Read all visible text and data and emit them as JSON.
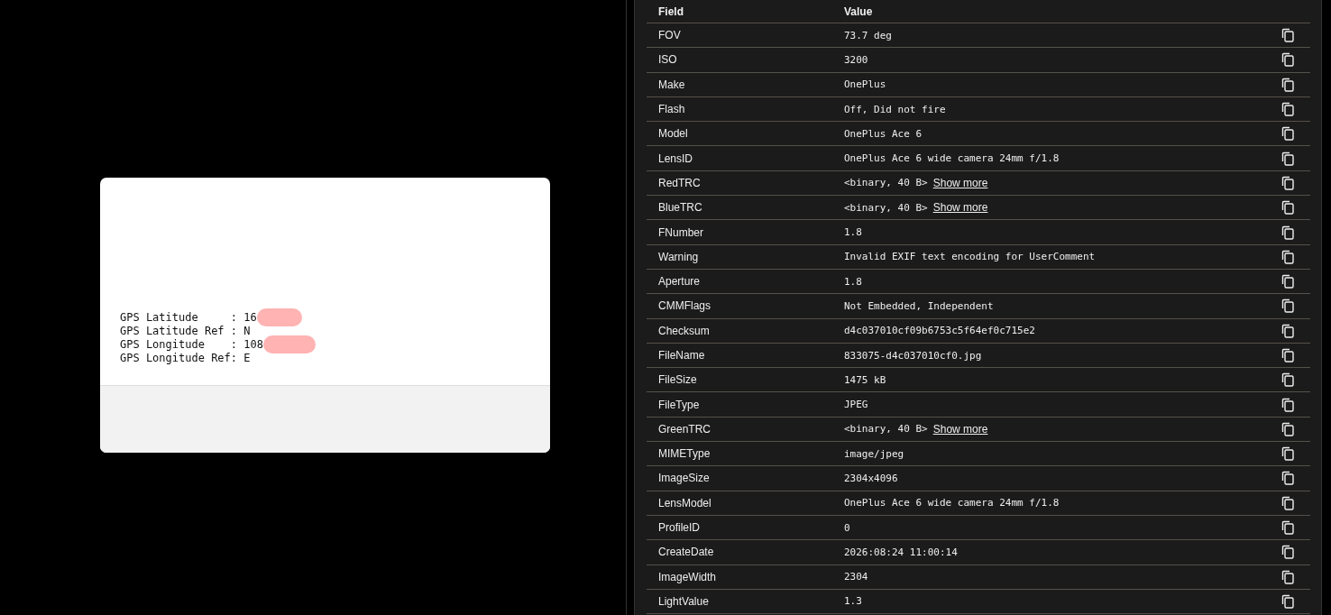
{
  "preview_card": {
    "lines": [
      {
        "label": "GPS Latitude     : 16"
      },
      {
        "label": "GPS Latitude Ref : N"
      },
      {
        "label": "GPS Longitude    : 108"
      },
      {
        "label": "GPS Longitude Ref: E"
      }
    ]
  },
  "metadata_table": {
    "columns": [
      "Field",
      "Value"
    ],
    "rows": [
      {
        "field": "FOV",
        "value": "73.7 deg"
      },
      {
        "field": "ISO",
        "value": "3200"
      },
      {
        "field": "Make",
        "value": "OnePlus"
      },
      {
        "field": "Flash",
        "value": "Off, Did not fire"
      },
      {
        "field": "Model",
        "value": "OnePlus Ace 6"
      },
      {
        "field": "LensID",
        "value": "OnePlus Ace 6 wide camera 24mm f/1.8"
      },
      {
        "field": "RedTRC",
        "value": "<binary, 40 B>",
        "link": "Show more"
      },
      {
        "field": "BlueTRC",
        "value": "<binary, 40 B>",
        "link": "Show more"
      },
      {
        "field": "FNumber",
        "value": "1.8"
      },
      {
        "field": "Warning",
        "value": "Invalid EXIF text encoding for UserComment"
      },
      {
        "field": "Aperture",
        "value": "1.8"
      },
      {
        "field": "CMMFlags",
        "value": "Not Embedded, Independent"
      },
      {
        "field": "Checksum",
        "value": "d4c037010cf09b6753c5f64ef0c715e2"
      },
      {
        "field": "FileName",
        "value": "833075-d4c037010cf0.jpg"
      },
      {
        "field": "FileSize",
        "value": "1475 kB"
      },
      {
        "field": "FileType",
        "value": "JPEG"
      },
      {
        "field": "GreenTRC",
        "value": "<binary, 40 B>",
        "link": "Show more"
      },
      {
        "field": "MIMEType",
        "value": "image/jpeg"
      },
      {
        "field": "ImageSize",
        "value": "2304x4096"
      },
      {
        "field": "LensModel",
        "value": "OnePlus Ace 6 wide camera 24mm f/1.8"
      },
      {
        "field": "ProfileID",
        "value": "0"
      },
      {
        "field": "CreateDate",
        "value": "2026:08:24 11:00:14"
      },
      {
        "field": "ImageWidth",
        "value": "2304"
      },
      {
        "field": "LightValue",
        "value": "1.3"
      }
    ]
  }
}
